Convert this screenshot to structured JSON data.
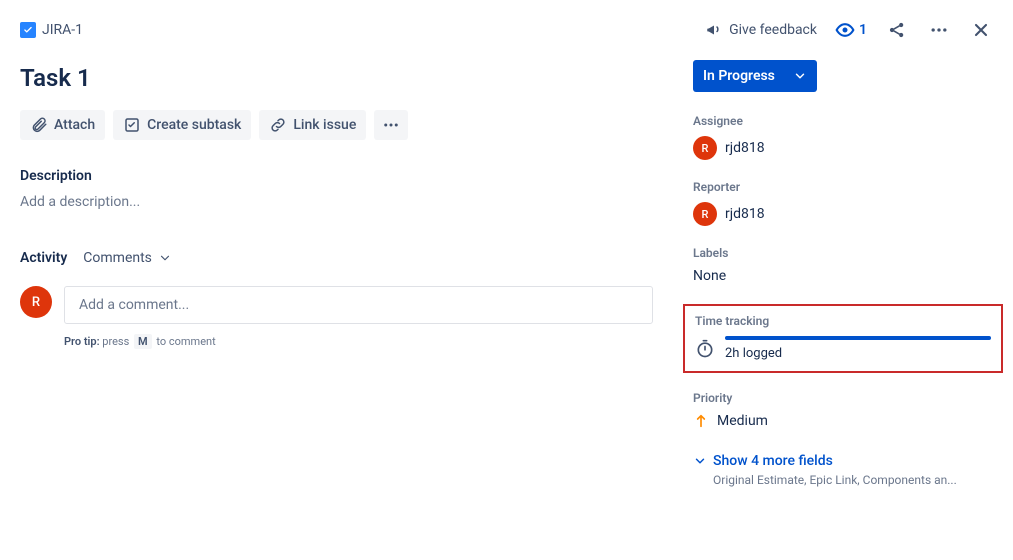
{
  "breadcrumb": {
    "issue_key": "JIRA-1"
  },
  "top_actions": {
    "feedback_label": "Give feedback",
    "watch_count": "1"
  },
  "title": "Task 1",
  "action_buttons": {
    "attach": "Attach",
    "create_subtask": "Create subtask",
    "link_issue": "Link issue"
  },
  "description": {
    "label": "Description",
    "placeholder": "Add a description..."
  },
  "activity": {
    "label": "Activity",
    "filter": "Comments",
    "comment_placeholder": "Add a comment...",
    "avatar_initial": "R",
    "pro_tip_prefix": "Pro tip:",
    "pro_tip_text_a": "press",
    "pro_tip_key": "M",
    "pro_tip_text_b": "to comment"
  },
  "status": {
    "label": "In Progress"
  },
  "assignee": {
    "label": "Assignee",
    "avatar_initial": "R",
    "name": "rjd818"
  },
  "reporter": {
    "label": "Reporter",
    "avatar_initial": "R",
    "name": "rjd818"
  },
  "labels": {
    "label": "Labels",
    "value": "None"
  },
  "time_tracking": {
    "label": "Time tracking",
    "logged": "2h logged"
  },
  "priority": {
    "label": "Priority",
    "value": "Medium"
  },
  "show_more": {
    "label": "Show 4 more fields",
    "sub": "Original Estimate, Epic Link, Components an..."
  }
}
